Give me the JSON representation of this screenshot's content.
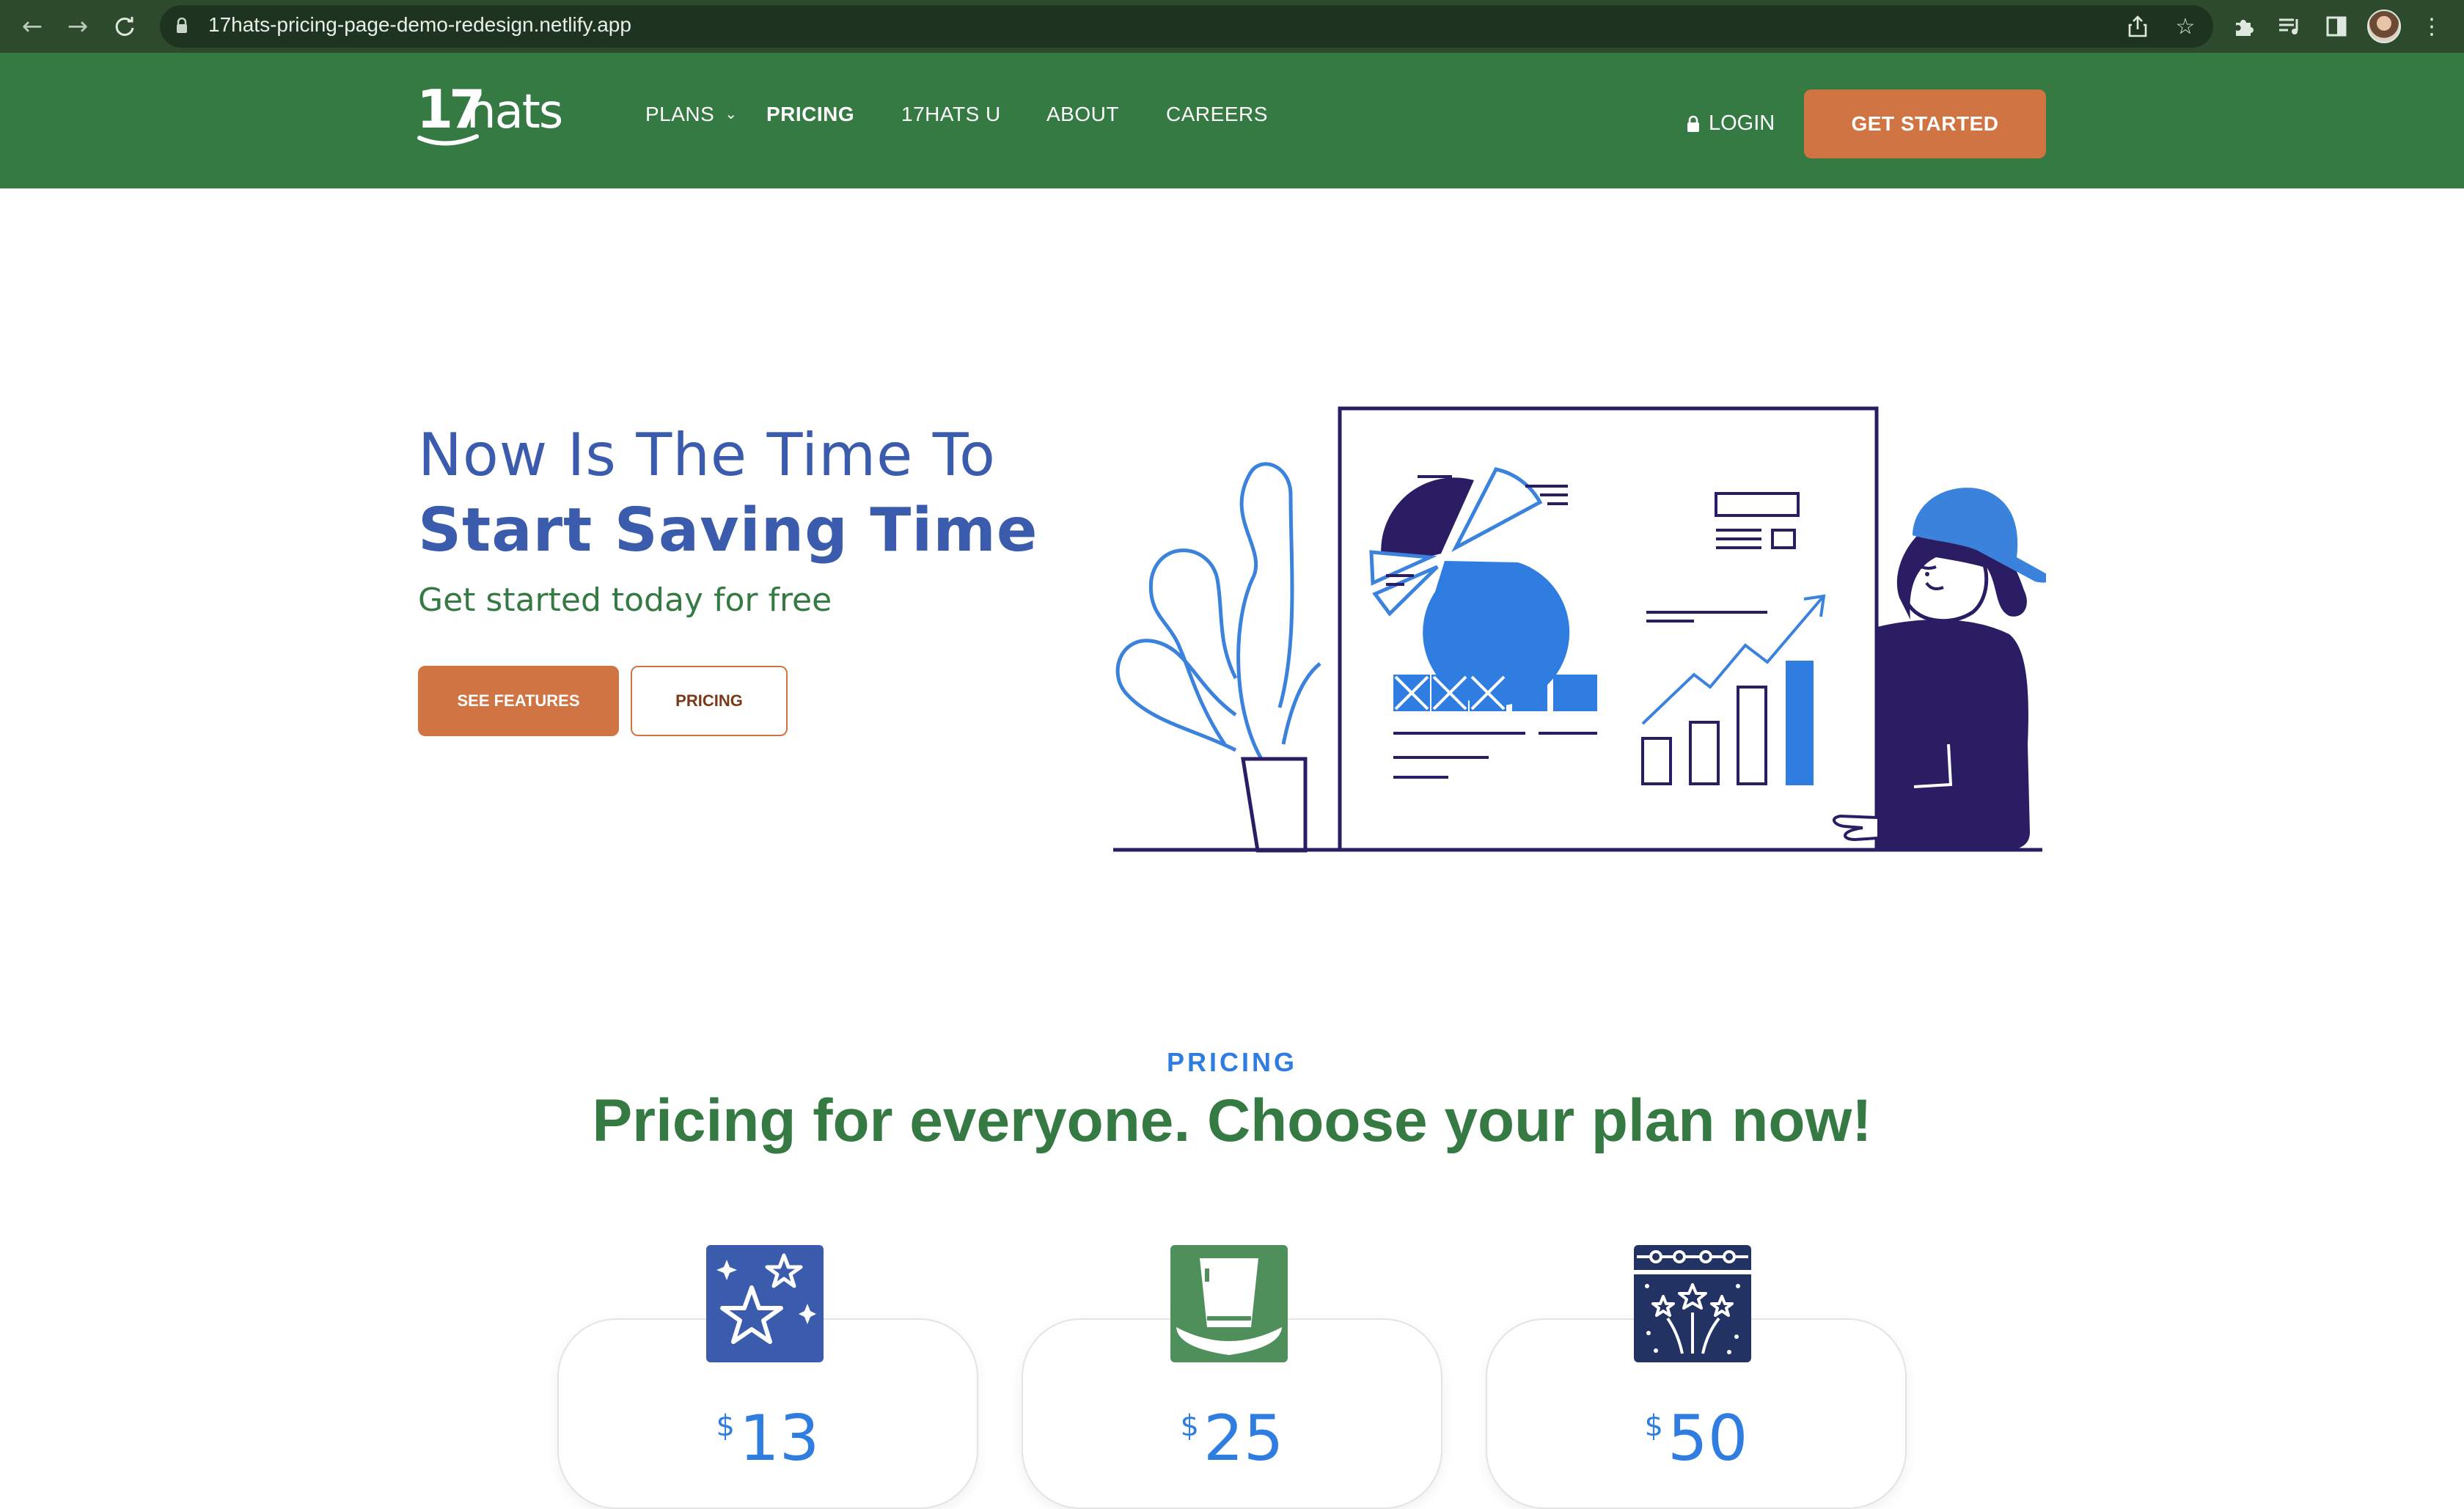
{
  "browser": {
    "url": "17hats-pricing-page-demo-redesign.netlify.app",
    "icons": [
      "back-icon",
      "forward-icon",
      "reload-icon",
      "lock-icon",
      "share-icon",
      "star-icon",
      "extensions-icon",
      "media-icon",
      "sidebar-icon",
      "menu-icon"
    ]
  },
  "header": {
    "logo_text": "17hats",
    "nav": [
      {
        "label": "PLANS",
        "has_dropdown": true
      },
      {
        "label": "PRICING",
        "active": true
      },
      {
        "label": "17HATS U"
      },
      {
        "label": "ABOUT"
      },
      {
        "label": "CAREERS"
      }
    ],
    "login_label": "LOGIN",
    "cta_label": "GET STARTED"
  },
  "hero": {
    "line1": "Now Is The Time To",
    "line2": "Start Saving Time",
    "subtitle": "Get started today for free",
    "primary_button": "SEE FEATURES",
    "secondary_button": "PRICING"
  },
  "pricing": {
    "eyebrow": "PRICING",
    "heading": "Pricing for everyone. Choose your plan now!",
    "plans": [
      {
        "icon": "stars-icon",
        "currency": "$",
        "price": "13",
        "icon_color": "#3b5cad"
      },
      {
        "icon": "top-hat-icon",
        "currency": "$",
        "price": "25",
        "icon_color": "#4f8f5b"
      },
      {
        "icon": "calendar-fireworks-icon",
        "currency": "$",
        "price": "50",
        "icon_color": "#213263"
      }
    ]
  },
  "colors": {
    "brand_green": "#357943",
    "cta_orange": "#cf7442",
    "hero_blue": "#3b5cad",
    "accent_blue": "#2f7de1",
    "ink_navy": "#2a1d63"
  }
}
